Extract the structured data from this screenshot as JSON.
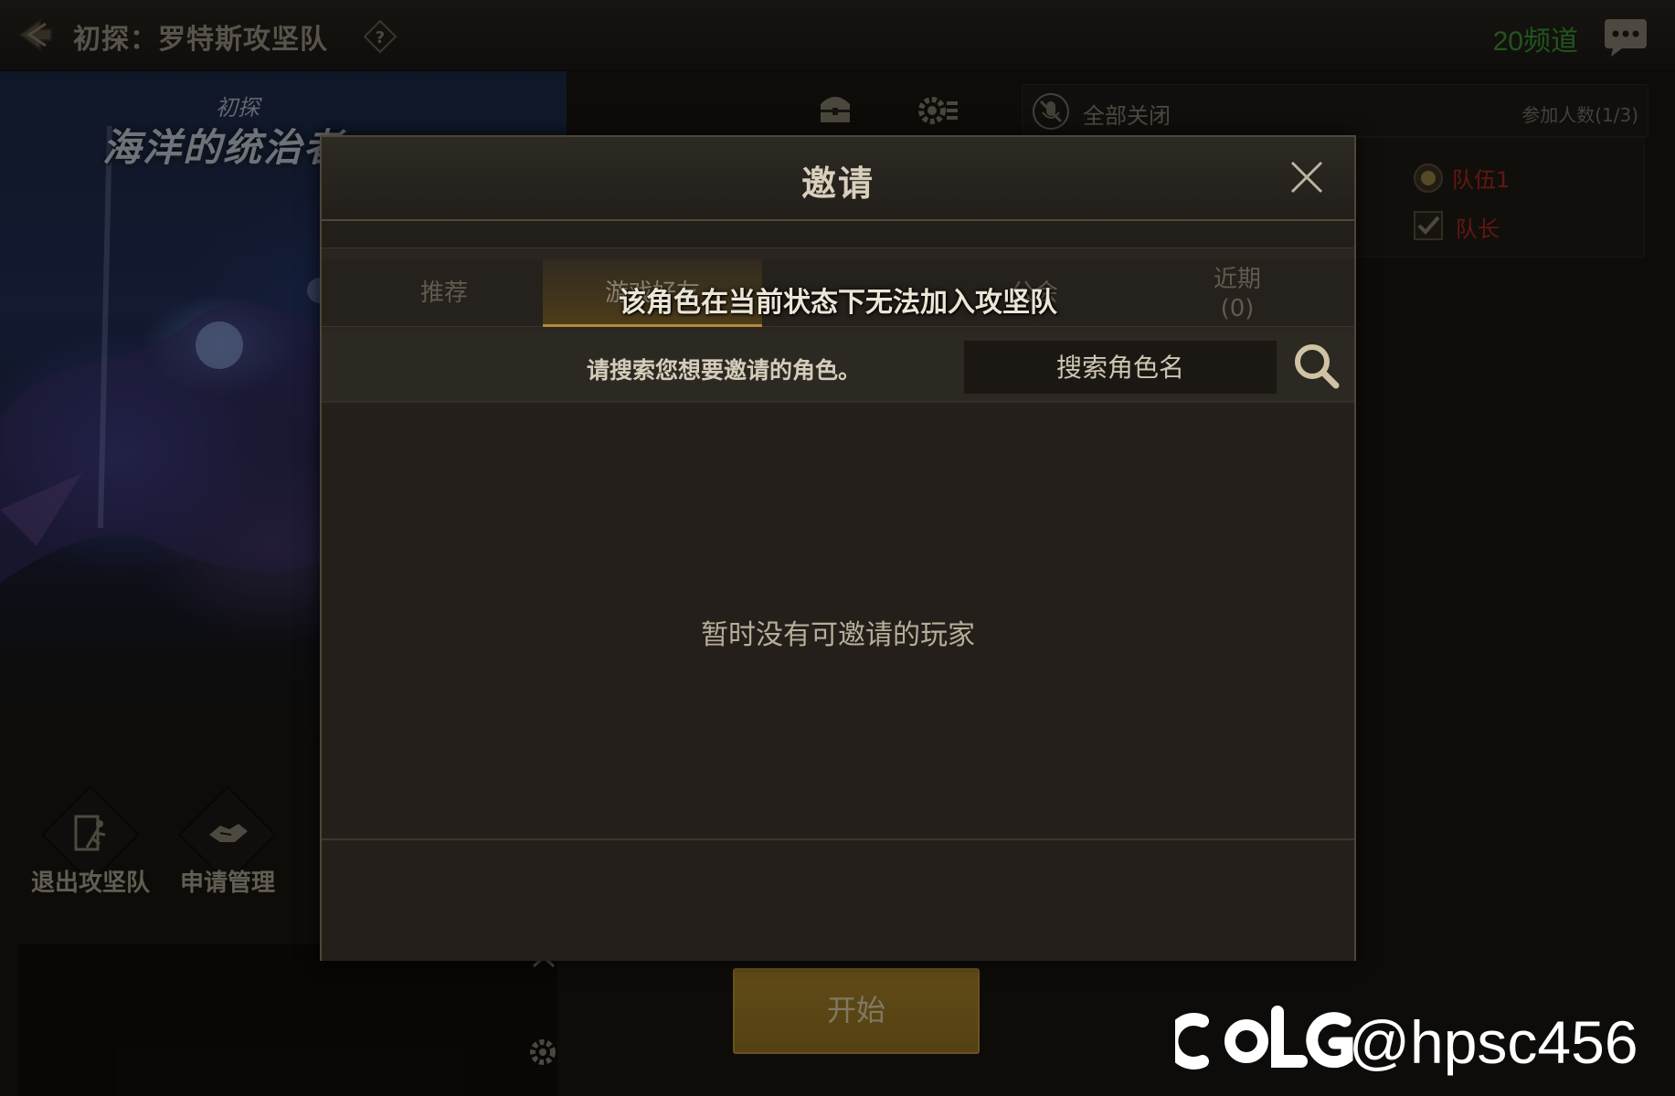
{
  "topbar": {
    "title": "初探：罗特斯攻坚队",
    "channel": "20频道"
  },
  "background": {
    "dungeon_subtitle": "初探",
    "dungeon_name": "海洋的统治者"
  },
  "party": {
    "mute_all_label": "全部关闭",
    "participant_count": "参加人数(1/3)",
    "team_label": "队伍1",
    "leader_label": "队长"
  },
  "actions": [
    {
      "label": "退出攻坚队"
    },
    {
      "label": "申请管理"
    }
  ],
  "start_button": "开始",
  "modal": {
    "title": "邀请",
    "tabs": [
      {
        "label": "推荐"
      },
      {
        "label": "游戏好友"
      },
      {
        "label": "公会"
      },
      {
        "label": "近期",
        "count": "(0)"
      }
    ],
    "toast": "该角色在当前状态下无法加入攻坚队",
    "search_hint": "请搜索您想要邀请的角色。",
    "search_placeholder": "搜索角色名",
    "empty_message": "暂时没有可邀请的玩家"
  },
  "watermark": "@hpsc456",
  "colors": {
    "accent_gold": "#b18a37",
    "channel_green": "#3e9a36",
    "team_red": "#b12a22"
  }
}
